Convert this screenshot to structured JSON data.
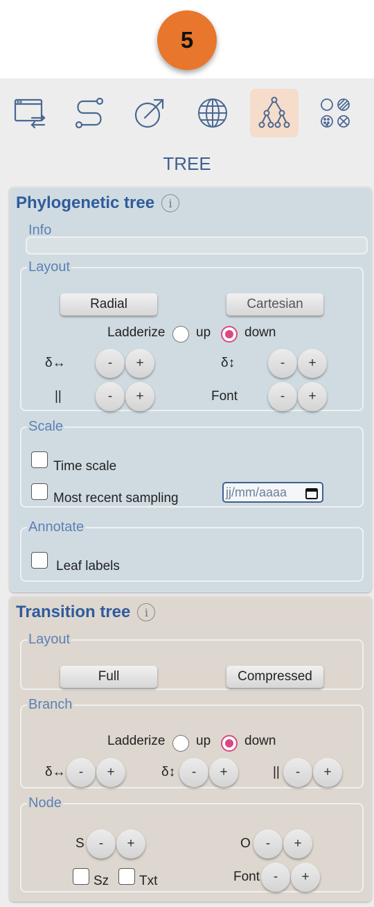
{
  "step": "5",
  "toolbar": {
    "icons": [
      "window-swap-icon",
      "path-icon",
      "arrow-circle-icon",
      "globe-icon",
      "tree-icon",
      "patterns-icon"
    ],
    "active": "tree-icon"
  },
  "panel_title": "TREE",
  "phylo": {
    "title": "Phylogenetic tree",
    "info_glyph": "i",
    "info_legend": "Info",
    "layout_legend": "Layout",
    "radial": "Radial",
    "cartesian": "Cartesian",
    "ladderize": "Ladderize",
    "up": "up",
    "down": "down",
    "ladderize_selected": "down",
    "h_spacing": "δ↔",
    "v_spacing": "δ↕",
    "width_label": "||",
    "font_label": "Font",
    "minus": "-",
    "plus": "+",
    "scale_legend": "Scale",
    "time_scale": "Time scale",
    "most_recent": "Most recent sampling",
    "date_placeholder": "jj/mm/aaaa",
    "annotate_legend": "Annotate",
    "leaf_labels": "Leaf labels"
  },
  "transition": {
    "title": "Transition tree",
    "info_glyph": "i",
    "layout_legend": "Layout",
    "full": "Full",
    "compressed": "Compressed",
    "branch_legend": "Branch",
    "ladderize": "Ladderize",
    "up": "up",
    "down": "down",
    "ladderize_selected": "down",
    "h_spacing": "δ↔",
    "v_spacing": "δ↕",
    "width_label": "||",
    "minus": "-",
    "plus": "+",
    "node_legend": "Node",
    "s_label": "S",
    "o_label": "O",
    "sz": "Sz",
    "txt": "Txt",
    "font_label": "Font"
  },
  "colors": {
    "badge": "#e8762c",
    "accent_text": "#2f5b9c",
    "radio_selected": "#d84a7f",
    "phylo_bg": "#d0dbe1",
    "transition_bg": "#ded7cf",
    "active_tool_bg": "#f6dccb"
  }
}
